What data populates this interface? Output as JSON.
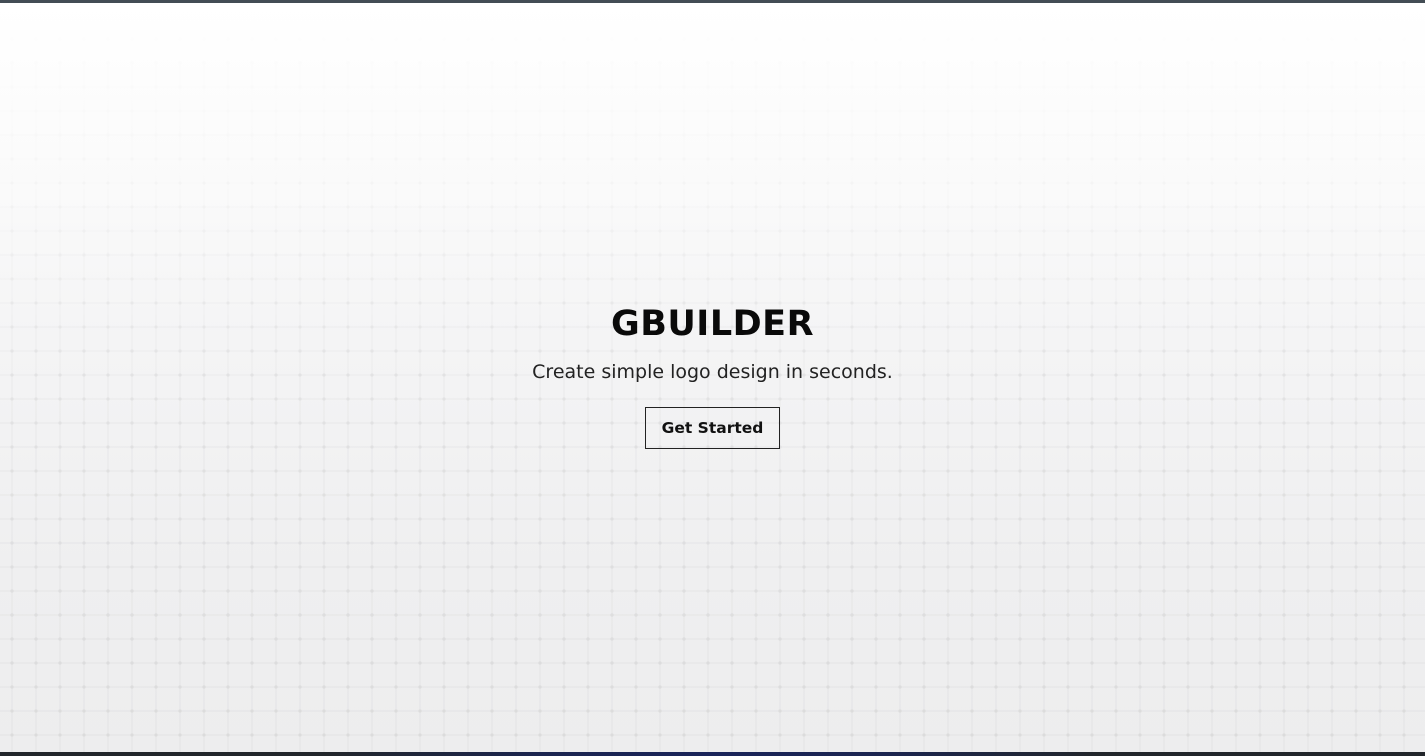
{
  "hero": {
    "title": "GBUILDER",
    "subtitle": "Create simple logo design in seconds.",
    "cta_label": "Get Started"
  },
  "colors": {
    "top_border": "#434d55",
    "text": "#0a0a0a",
    "bottom_bar": "#1a245a"
  }
}
